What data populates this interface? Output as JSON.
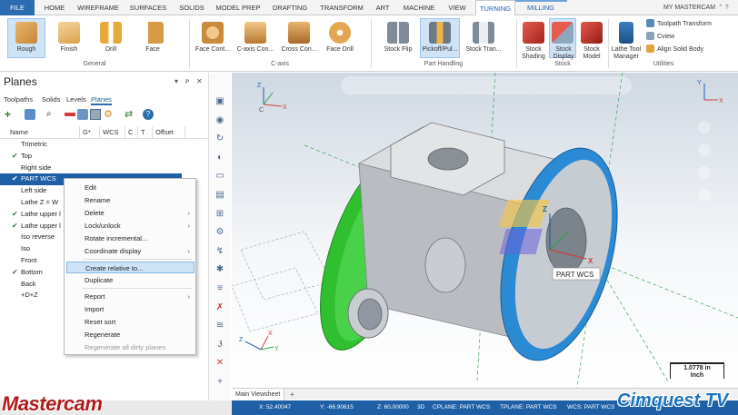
{
  "ribbon": {
    "tabs": [
      "FILE",
      "HOME",
      "WIREFRAME",
      "SURFACES",
      "SOLIDS",
      "MODEL PREP",
      "DRAFTING",
      "TRANSFORM",
      "ART",
      "MACHINE",
      "VIEW",
      "TURNING",
      "MILLING"
    ],
    "active_tab": "TURNING",
    "right_label": "MY MASTERCAM",
    "general": {
      "label": "General",
      "buttons": [
        "Rough",
        "Finish",
        "Drill",
        "Face"
      ]
    },
    "caxis": {
      "label": "C-axis",
      "buttons": [
        "Face Cont...",
        "C-axis Con...",
        "Cross Con...",
        "Face Drill"
      ]
    },
    "part_handling": {
      "label": "Part Handling",
      "buttons": [
        "Stock Flip",
        "Pickoff/Pul...",
        "Stock Tran..."
      ]
    },
    "stock": {
      "label": "Stock",
      "buttons": [
        "Stock Shading",
        "Stock Display",
        "Stock Model"
      ]
    },
    "utilities": {
      "label": "Utilities",
      "buttons": [
        "Lathe Tool Manager"
      ],
      "items": [
        "Toolpath Transform",
        "Cview",
        "Align Solid Body"
      ]
    }
  },
  "planes_panel": {
    "title": "Planes",
    "tabs": [
      "Toolpaths",
      "Solids",
      "Levels",
      "Planes"
    ],
    "active_tab": "Planes",
    "columns": [
      "Name",
      "G*",
      "WCS",
      "C",
      "T",
      "Offset"
    ],
    "rows": [
      {
        "name": "Trimetric",
        "checked": false
      },
      {
        "name": "Top",
        "checked": true
      },
      {
        "name": "Right side",
        "checked": false
      },
      {
        "name": "PART WCS",
        "checked": true,
        "selected": true
      },
      {
        "name": "Left side",
        "checked": false
      },
      {
        "name": "Lathe Z = W",
        "checked": false
      },
      {
        "name": "Lathe upper l",
        "checked": true
      },
      {
        "name": "Lathe upper l",
        "checked": true
      },
      {
        "name": "Iso reverse",
        "checked": false
      },
      {
        "name": "Iso",
        "checked": false
      },
      {
        "name": "Front",
        "checked": false
      },
      {
        "name": "Bottom",
        "checked": true
      },
      {
        "name": "Back",
        "checked": false
      },
      {
        "name": "+D+Z",
        "checked": false
      }
    ]
  },
  "context_menu": {
    "items": [
      {
        "label": "Edit",
        "arrow": false
      },
      {
        "label": "Rename",
        "arrow": false
      },
      {
        "label": "Delete",
        "arrow": true
      },
      {
        "label": "Lock/unlock",
        "arrow": true
      },
      {
        "label": "Rotate incremental...",
        "arrow": false
      },
      {
        "label": "Coordinate display",
        "arrow": true
      },
      {
        "label": "Create relative to...",
        "arrow": false,
        "highlighted": true
      },
      {
        "label": "Duplicate",
        "arrow": false
      },
      {
        "label": "Report",
        "arrow": true
      },
      {
        "label": "Import",
        "arrow": false
      },
      {
        "label": "Reset sort",
        "arrow": false
      },
      {
        "label": "Regenerate",
        "arrow": false
      },
      {
        "label": "Regenerate all dirty planes",
        "arrow": false,
        "disabled": true
      }
    ]
  },
  "viewport": {
    "tooltip": "PART WCS",
    "scale_value": "1.0778 in",
    "scale_unit": "Inch",
    "axis_labels": {
      "x": "X",
      "y": "Y",
      "z": "Z",
      "c": "C"
    },
    "sheet_tab": "Main Viewsheet",
    "sheet_add": "+"
  },
  "status_bar": {
    "x": "X:   52.40047",
    "y": "Y:   -66.90615",
    "z": "Z:   60.00000",
    "mode": "3D",
    "cplane": "CPLANE: PART WCS",
    "tplane": "TPLANE: PART WCS",
    "wcs": "WCS: PART WCS"
  },
  "logos": {
    "left": "Mastercam",
    "right": "Cimquest TV"
  },
  "colors": {
    "accent": "#1e5fa6",
    "green_face": "#2fbf2f",
    "blue_face": "#2a8ad4",
    "check": "#2e7d32"
  }
}
